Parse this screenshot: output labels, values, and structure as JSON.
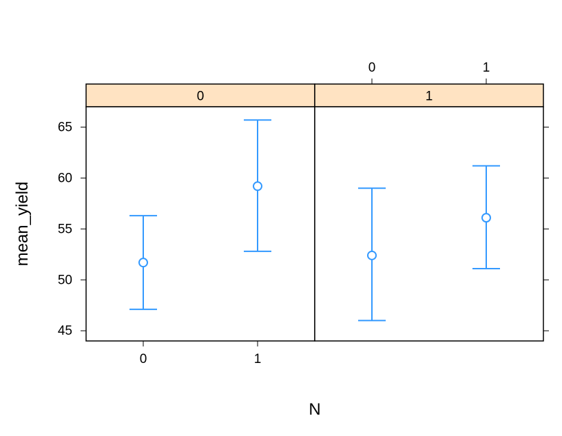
{
  "chart_data": {
    "type": "errorbar",
    "ylabel": "mean_yield",
    "xlabel": "N",
    "ylim": [
      44,
      67
    ],
    "yticks": [
      45,
      50,
      55,
      60,
      65
    ],
    "strip_color": "#ffe3c2",
    "strip_text_color": "#000000",
    "border_color": "#000000",
    "point_color": "#3399ff",
    "bg_color": "#ffffff",
    "panels": [
      {
        "label": "0",
        "axis_side": "bottom",
        "categories": [
          "0",
          "1"
        ],
        "points": [
          {
            "mean": 51.7,
            "low": 47.1,
            "high": 56.3
          },
          {
            "mean": 59.2,
            "low": 52.8,
            "high": 65.7
          }
        ]
      },
      {
        "label": "1",
        "axis_side": "top",
        "categories": [
          "0",
          "1"
        ],
        "points": [
          {
            "mean": 52.4,
            "low": 46.0,
            "high": 59.0
          },
          {
            "mean": 56.1,
            "low": 51.1,
            "high": 61.2
          }
        ]
      }
    ]
  }
}
